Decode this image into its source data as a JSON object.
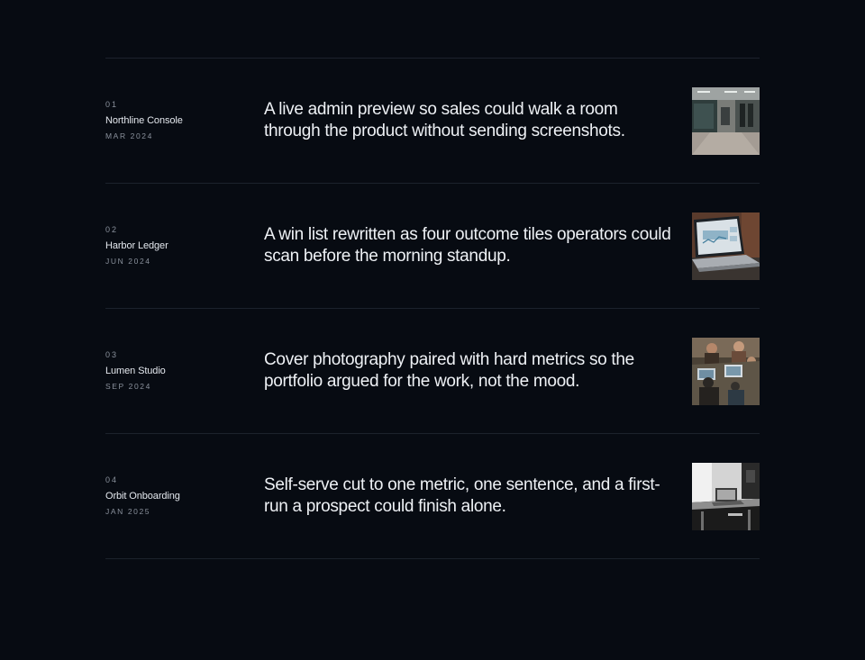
{
  "projects": [
    {
      "number": "01",
      "name": "Northline Console",
      "date": "MAR 2024",
      "summary": "A live admin preview so sales could walk a room through the product without sending screenshots.",
      "image": "office-corridor-photo"
    },
    {
      "number": "02",
      "name": "Harbor Ledger",
      "date": "JUN 2024",
      "summary": "A win list rewritten as four outcome tiles operators could scan before the morning standup.",
      "image": "laptop-dashboard-photo"
    },
    {
      "number": "03",
      "name": "Lumen Studio",
      "date": "SEP 2024",
      "summary": "Cover photography paired with hard metrics so the portfolio argued for the work, not the mood.",
      "image": "team-meeting-photo"
    },
    {
      "number": "04",
      "name": "Orbit Onboarding",
      "date": "JAN 2025",
      "summary": "Self-serve cut to one metric, one sentence, and a first-run a prospect could finish alone.",
      "image": "monochrome-workspace-photo"
    }
  ]
}
